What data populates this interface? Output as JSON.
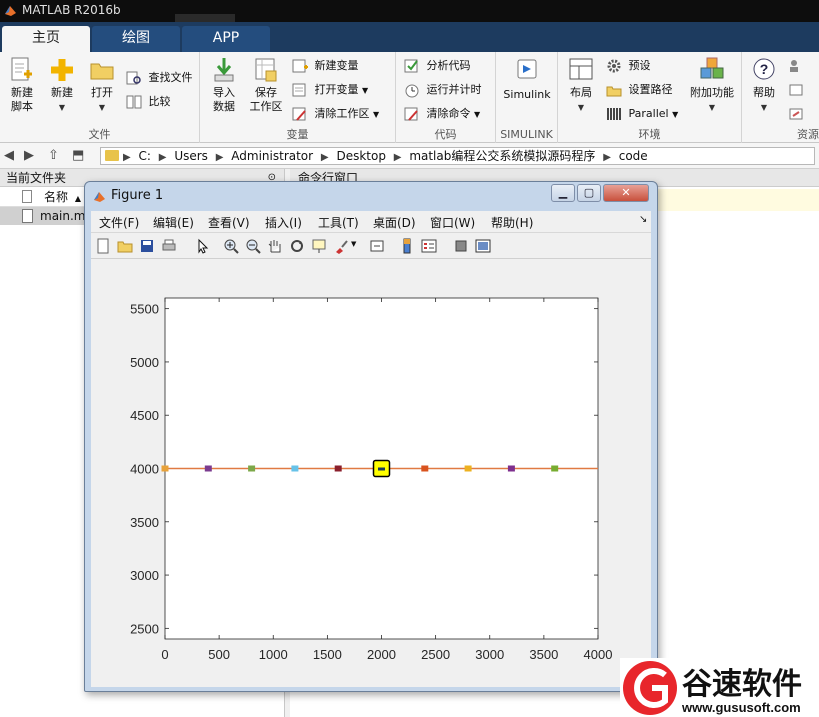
{
  "app": {
    "title": "MATLAB R2016b",
    "tabs": [
      "主页",
      "绘图",
      "APP"
    ]
  },
  "ribbon": {
    "file": {
      "label": "文件",
      "new_script": "新建\n脚本",
      "new": "新建",
      "open": "打开",
      "find_files": "查找文件",
      "compare": "比较"
    },
    "variable": {
      "label": "变量",
      "import": "导入\n数据",
      "save_ws": "保存\n工作区",
      "new_var": "新建变量",
      "open_var": "打开变量",
      "clear_ws": "清除工作区"
    },
    "code": {
      "label": "代码",
      "analyze": "分析代码",
      "run_time": "运行并计时",
      "clear_cmds": "清除命令"
    },
    "simulink": {
      "label": "SIMULINK",
      "btn": "Simulink"
    },
    "env": {
      "label": "环境",
      "layout": "布局",
      "prefs": "预设",
      "set_path": "设置路径",
      "parallel": "Parallel",
      "addons": "附加功能"
    },
    "resources": {
      "label": "资源",
      "help": "帮助"
    }
  },
  "address": {
    "crumbs": [
      "C:",
      "Users",
      "Administrator",
      "Desktop",
      "matlab编程公交系统模拟源码程序",
      "code"
    ]
  },
  "current_folder": {
    "header": "当前文件夹",
    "col_name": "名称",
    "file": "main.m"
  },
  "command_window": {
    "header": "命令行窗口"
  },
  "figure": {
    "title": "Figure 1",
    "menu": [
      "文件(F)",
      "编辑(E)",
      "查看(V)",
      "插入(I)",
      "工具(T)",
      "桌面(D)",
      "窗口(W)",
      "帮助(H)"
    ]
  },
  "chart_data": {
    "type": "line",
    "xlim": [
      0,
      4000
    ],
    "ylim": [
      2400,
      5600
    ],
    "xticks": [
      0,
      500,
      1000,
      1500,
      2000,
      2500,
      3000,
      3500,
      4000
    ],
    "yticks": [
      2500,
      3000,
      3500,
      4000,
      4500,
      5000,
      5500
    ],
    "line": {
      "x": [
        0,
        4000
      ],
      "y": [
        4000,
        4000
      ],
      "color": "#e07a42"
    },
    "markers": [
      {
        "x": 0,
        "y": 4000,
        "color": "#e8a23a"
      },
      {
        "x": 400,
        "y": 4000,
        "color": "#7b3b8f"
      },
      {
        "x": 800,
        "y": 4000,
        "color": "#7da84a"
      },
      {
        "x": 1200,
        "y": 4000,
        "color": "#66c2e8"
      },
      {
        "x": 1600,
        "y": 4000,
        "color": "#8a1f2c"
      },
      {
        "x": 2400,
        "y": 4000,
        "color": "#d9531e"
      },
      {
        "x": 2800,
        "y": 4000,
        "color": "#edb120"
      },
      {
        "x": 3200,
        "y": 4000,
        "color": "#7e2f8e"
      },
      {
        "x": 3600,
        "y": 4000,
        "color": "#77ac30"
      }
    ],
    "highlight": {
      "x": 2000,
      "y": 4000,
      "fill": "#ffff00",
      "edge": "#000000"
    }
  },
  "watermark": {
    "brand": "谷速软件",
    "url": "www.gususoft.com",
    "color": "#e8262b"
  }
}
